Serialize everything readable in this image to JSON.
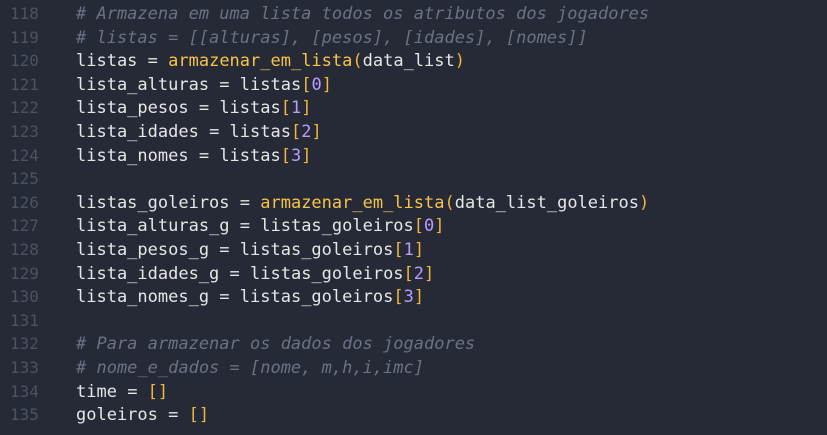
{
  "colors": {
    "background": "#252a36",
    "line_number": "#4c5264",
    "text": "#e6e6e6",
    "comment": "#6b7287",
    "function": "#f7c44a",
    "bracket": "#f2b63c",
    "number": "#b99cff"
  },
  "lines": [
    {
      "num": "118",
      "tokens": [
        {
          "t": "comment",
          "v": "# Armazena em uma lista todos os atributos dos jogadores"
        }
      ]
    },
    {
      "num": "119",
      "tokens": [
        {
          "t": "comment",
          "v": "# listas = [[alturas], [pesos], [idades], [nomes]]"
        }
      ]
    },
    {
      "num": "120",
      "tokens": [
        {
          "t": "ident",
          "v": "listas "
        },
        {
          "t": "op",
          "v": "= "
        },
        {
          "t": "func",
          "v": "armazenar_em_lista"
        },
        {
          "t": "bracket",
          "v": "("
        },
        {
          "t": "ident",
          "v": "data_list"
        },
        {
          "t": "bracket",
          "v": ")"
        }
      ]
    },
    {
      "num": "121",
      "tokens": [
        {
          "t": "ident",
          "v": "lista_alturas "
        },
        {
          "t": "op",
          "v": "= "
        },
        {
          "t": "ident",
          "v": "listas"
        },
        {
          "t": "bracket",
          "v": "["
        },
        {
          "t": "num",
          "v": "0"
        },
        {
          "t": "bracket",
          "v": "]"
        }
      ]
    },
    {
      "num": "122",
      "tokens": [
        {
          "t": "ident",
          "v": "lista_pesos "
        },
        {
          "t": "op",
          "v": "= "
        },
        {
          "t": "ident",
          "v": "listas"
        },
        {
          "t": "bracket",
          "v": "["
        },
        {
          "t": "num",
          "v": "1"
        },
        {
          "t": "bracket",
          "v": "]"
        }
      ]
    },
    {
      "num": "123",
      "tokens": [
        {
          "t": "ident",
          "v": "lista_idades "
        },
        {
          "t": "op",
          "v": "= "
        },
        {
          "t": "ident",
          "v": "listas"
        },
        {
          "t": "bracket",
          "v": "["
        },
        {
          "t": "num",
          "v": "2"
        },
        {
          "t": "bracket",
          "v": "]"
        }
      ]
    },
    {
      "num": "124",
      "tokens": [
        {
          "t": "ident",
          "v": "lista_nomes "
        },
        {
          "t": "op",
          "v": "= "
        },
        {
          "t": "ident",
          "v": "listas"
        },
        {
          "t": "bracket",
          "v": "["
        },
        {
          "t": "num",
          "v": "3"
        },
        {
          "t": "bracket",
          "v": "]"
        }
      ]
    },
    {
      "num": "125",
      "tokens": []
    },
    {
      "num": "126",
      "tokens": [
        {
          "t": "ident",
          "v": "listas_goleiros "
        },
        {
          "t": "op",
          "v": "= "
        },
        {
          "t": "func",
          "v": "armazenar_em_lista"
        },
        {
          "t": "bracket",
          "v": "("
        },
        {
          "t": "ident",
          "v": "data_list_goleiros"
        },
        {
          "t": "bracket",
          "v": ")"
        }
      ]
    },
    {
      "num": "127",
      "tokens": [
        {
          "t": "ident",
          "v": "lista_alturas_g "
        },
        {
          "t": "op",
          "v": "= "
        },
        {
          "t": "ident",
          "v": "listas_goleiros"
        },
        {
          "t": "bracket",
          "v": "["
        },
        {
          "t": "num",
          "v": "0"
        },
        {
          "t": "bracket",
          "v": "]"
        }
      ]
    },
    {
      "num": "128",
      "tokens": [
        {
          "t": "ident",
          "v": "lista_pesos_g "
        },
        {
          "t": "op",
          "v": "= "
        },
        {
          "t": "ident",
          "v": "listas_goleiros"
        },
        {
          "t": "bracket",
          "v": "["
        },
        {
          "t": "num",
          "v": "1"
        },
        {
          "t": "bracket",
          "v": "]"
        }
      ]
    },
    {
      "num": "129",
      "tokens": [
        {
          "t": "ident",
          "v": "lista_idades_g "
        },
        {
          "t": "op",
          "v": "= "
        },
        {
          "t": "ident",
          "v": "listas_goleiros"
        },
        {
          "t": "bracket",
          "v": "["
        },
        {
          "t": "num",
          "v": "2"
        },
        {
          "t": "bracket",
          "v": "]"
        }
      ]
    },
    {
      "num": "130",
      "tokens": [
        {
          "t": "ident",
          "v": "lista_nomes_g "
        },
        {
          "t": "op",
          "v": "= "
        },
        {
          "t": "ident",
          "v": "listas_goleiros"
        },
        {
          "t": "bracket",
          "v": "["
        },
        {
          "t": "num",
          "v": "3"
        },
        {
          "t": "bracket",
          "v": "]"
        }
      ]
    },
    {
      "num": "131",
      "tokens": []
    },
    {
      "num": "132",
      "tokens": [
        {
          "t": "comment",
          "v": "# Para armazenar os dados dos jogadores"
        }
      ]
    },
    {
      "num": "133",
      "tokens": [
        {
          "t": "comment",
          "v": "# nome_e_dados = [nome, m,h,i,imc]"
        }
      ]
    },
    {
      "num": "134",
      "tokens": [
        {
          "t": "ident",
          "v": "time "
        },
        {
          "t": "op",
          "v": "= "
        },
        {
          "t": "bracket",
          "v": "[]"
        }
      ]
    },
    {
      "num": "135",
      "tokens": [
        {
          "t": "ident",
          "v": "goleiros "
        },
        {
          "t": "op",
          "v": "= "
        },
        {
          "t": "bracket",
          "v": "[]"
        }
      ]
    }
  ]
}
